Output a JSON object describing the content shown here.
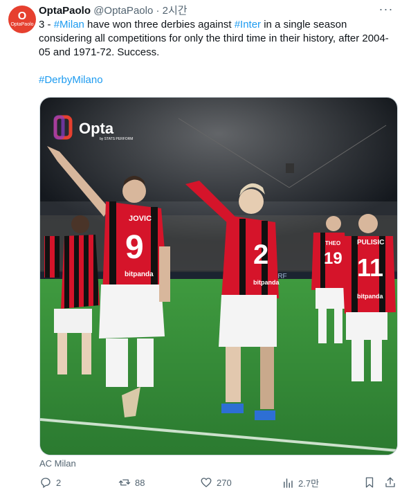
{
  "author": {
    "avatar_big": "O",
    "avatar_small": "OptaPaolo",
    "display_name": "OptaPaolo",
    "handle": "@OptaPaolo",
    "separator": "·",
    "time": "2시간"
  },
  "tweet": {
    "text_part1": "3 - ",
    "mention1": "#Milan",
    "text_part2": " have won three derbies against ",
    "mention2": "#Inter",
    "text_part3": " in a single season considering all competitions for only the third time in their history, after 2004-05 and 1971-72. Success.",
    "hashtag": "#DerbyMilano"
  },
  "image": {
    "logo_text": "Opta",
    "logo_sub": "by STATS PERFORM",
    "player1_name": "JOVIC",
    "player1_number": "9",
    "player2_number": "2",
    "player3_name": "THEO",
    "player3_number": "19",
    "player4_name": "PULISIC",
    "player4_number": "11",
    "sponsor": "bitpanda",
    "board": "PERF"
  },
  "credit": "AC Milan",
  "actions": {
    "replies": "2",
    "retweets": "88",
    "likes": "270",
    "views": "2.7만"
  },
  "colors": {
    "link": "#1d9bf0",
    "muted": "#536471",
    "milan_red": "#d5142a",
    "milan_black": "#111111",
    "pitch": "#2e8a36"
  }
}
